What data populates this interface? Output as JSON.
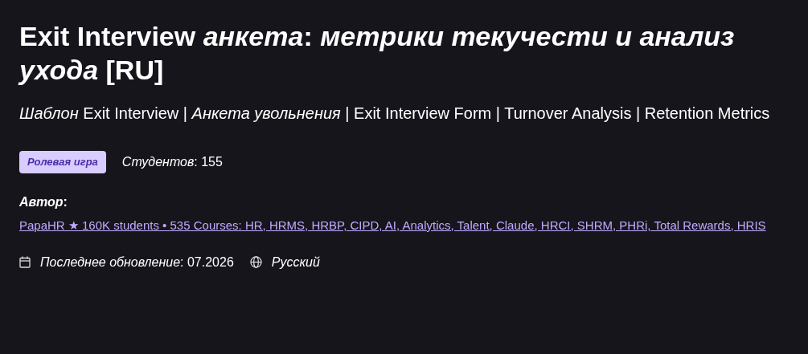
{
  "title": "Exit Interview *анкета*: *метрики текучести и анализ ухода* [RU]",
  "subtitle": "*Шаблон* Exit Interview | *Анкета увольнения* | Exit Interview Form | Turnover Analysis | Retention Metrics",
  "badge": "Ролевая игра",
  "students": "*Студентов*: 155",
  "author_label": "*Автор*:",
  "author_link": "PapaHR ★ 160K students • 535 Courses: HR, HRMS, HRBP, CIPD, AI, Analytics, Talent, Claude, HRCI, SHRM, PHRi, Total Rewards, HRIS",
  "last_updated": "*Последнее обновление*: 07.2026",
  "language": "Русский"
}
